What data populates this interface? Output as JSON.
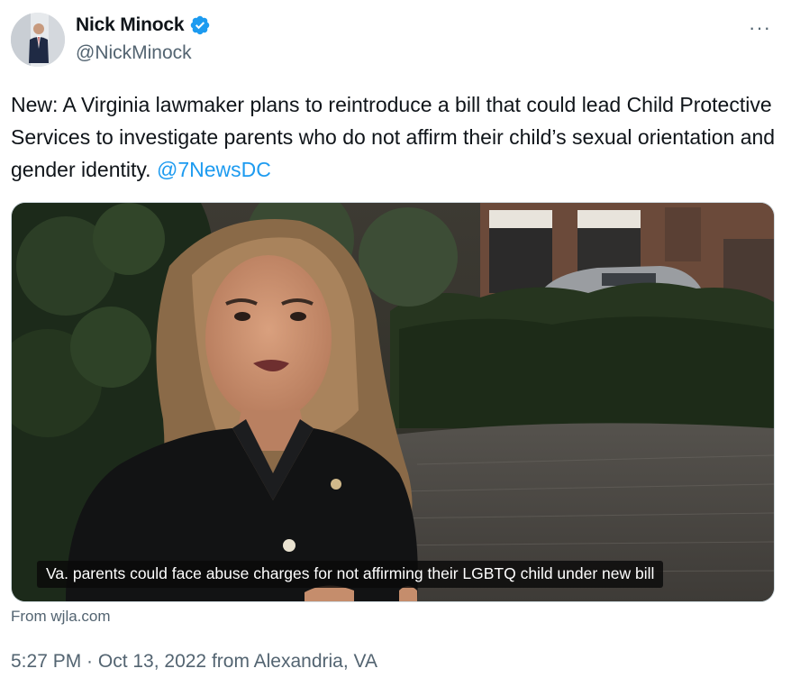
{
  "author": {
    "display_name": "Nick Minock",
    "handle": "@NickMinock",
    "verified": true
  },
  "more_menu": "···",
  "tweet": {
    "text": "New: A Virginia lawmaker plans to reintroduce a bill that could lead Child Protective Services to investigate parents who do not affirm their child’s sexual orientation and gender identity. ",
    "mention": "@7NewsDC"
  },
  "media": {
    "caption": "Va. parents could face abuse charges for not affirming their LGBTQ child under new bill",
    "source": "From wjla.com"
  },
  "meta": {
    "timestamp": "5:27 PM · Oct 13, 2022",
    "location": " from Alexandria, VA"
  },
  "colors": {
    "link": "#1d9bf0",
    "secondary_text": "#536471",
    "verified_badge": "#1d9bf0"
  }
}
